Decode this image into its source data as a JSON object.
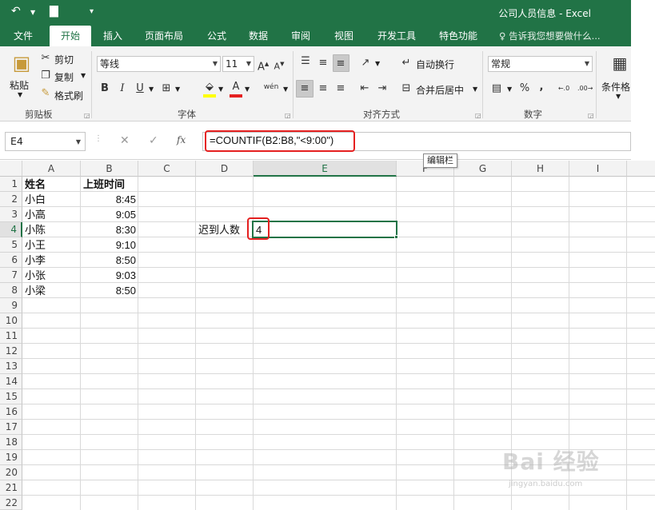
{
  "window": {
    "title": "公司人员信息 - Excel"
  },
  "tabs": [
    "文件",
    "开始",
    "插入",
    "页面布局",
    "公式",
    "数据",
    "审阅",
    "视图",
    "开发工具",
    "特色功能"
  ],
  "active_tab": "开始",
  "tell_me": "告诉我您想要做什么...",
  "ribbon": {
    "clipboard": {
      "paste": "粘贴",
      "cut": "剪切",
      "copy": "复制",
      "format_painter": "格式刷",
      "label": "剪贴板"
    },
    "font": {
      "name": "等线",
      "size": "11",
      "grow": "A",
      "shrink": "A",
      "bold": "B",
      "italic": "I",
      "underline": "U",
      "font_color_glyph": "A",
      "phonetic": "wén",
      "label": "字体"
    },
    "alignment": {
      "wrap_text": "自动换行",
      "merge_center": "合并后居中",
      "label": "对齐方式"
    },
    "number": {
      "format": "常规",
      "percent": "%",
      "comma": ",",
      "label": "数字"
    },
    "styles": {
      "conditional": "条件格"
    }
  },
  "formula_bar": {
    "name_box": "E4",
    "fx": "fx",
    "formula": "=COUNTIF(B2:B8,\"<9:00\")",
    "tooltip": "编辑栏"
  },
  "sheet": {
    "columns": [
      "A",
      "B",
      "C",
      "D",
      "E",
      "F",
      "G",
      "H",
      "I"
    ],
    "rows": [
      "1",
      "2",
      "3",
      "4",
      "5",
      "6",
      "7",
      "8",
      "9",
      "10",
      "11",
      "12",
      "13",
      "14",
      "15",
      "16",
      "17",
      "18",
      "19",
      "20",
      "21",
      "22"
    ],
    "header": {
      "name": "姓名",
      "time": "上班时间"
    },
    "records": [
      {
        "name": "小白",
        "time": "8:45"
      },
      {
        "name": "小高",
        "time": "9:05"
      },
      {
        "name": "小陈",
        "time": "8:30"
      },
      {
        "name": "小王",
        "time": "9:10"
      },
      {
        "name": "小李",
        "time": "8:50"
      },
      {
        "name": "小张",
        "time": "9:03"
      },
      {
        "name": "小梁",
        "time": "8:50"
      }
    ],
    "label_cell": "迟到人数",
    "result_cell": "4"
  },
  "watermark": {
    "main": "Bai 经验",
    "sub": "jingyan.baidu.com"
  },
  "colors": {
    "brand": "#217346",
    "highlight": "#e52020"
  }
}
